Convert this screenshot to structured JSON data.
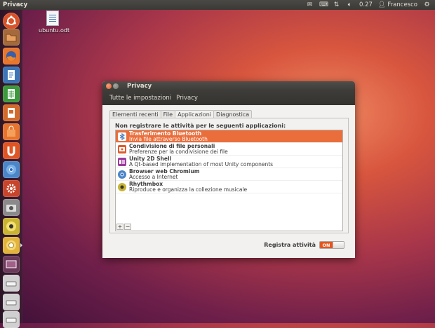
{
  "top_panel": {
    "app_title": "Privacy",
    "clock": "0.27",
    "user": "Francesco",
    "icons": [
      "mail-icon",
      "keyboard-icon",
      "network-icon",
      "volume-icon",
      "gear-icon"
    ]
  },
  "launcher": {
    "items": [
      {
        "name": "dash-home",
        "color": "#d8532a"
      },
      {
        "name": "files",
        "color": "#a56a3c"
      },
      {
        "name": "firefox",
        "color": "#e8762c"
      },
      {
        "name": "libreoffice-writer",
        "color": "#3a75b8"
      },
      {
        "name": "libreoffice-calc",
        "color": "#3c9a3c"
      },
      {
        "name": "libreoffice-impress",
        "color": "#d46a2a"
      },
      {
        "name": "software-center",
        "color": "#e6742e"
      },
      {
        "name": "ubuntu-one",
        "color": "#e05522"
      },
      {
        "name": "chromium",
        "color": "#4a86c8"
      },
      {
        "name": "system-settings",
        "color": "#c8442a"
      },
      {
        "name": "camera",
        "color": "#8a8a8a"
      },
      {
        "name": "rhythmbox",
        "color": "#c8b432"
      },
      {
        "name": "privacy",
        "color": "#e2b43a"
      },
      {
        "name": "workspace",
        "color": "#6b3a5a"
      },
      {
        "name": "drive-1",
        "color": "#d0d0d0"
      },
      {
        "name": "drive-2",
        "color": "#d0d0d0"
      },
      {
        "name": "drive-3",
        "color": "#d0d0d0"
      }
    ]
  },
  "desktop": {
    "file_label": "ubuntu.odt"
  },
  "window": {
    "title": "Privacy",
    "toolbar": {
      "all_settings": "Tutte le impostazioni",
      "current": "Privacy"
    },
    "tabs": [
      "Elementi recenti",
      "File",
      "Applicazioni",
      "Diagnostica"
    ],
    "active_tab": "Applicazioni",
    "heading": "Non registrare le attività per le seguenti applicazioni:",
    "apps": [
      {
        "name": "Trasferimento Bluetooth",
        "desc": "Invia file attraverso Bluetooth",
        "icon": "bluetooth-icon",
        "color": "#4a7bb8",
        "selected": true
      },
      {
        "name": "Condivisione di file personali",
        "desc": "Preferenze per la condivisione dei file",
        "icon": "file-share-icon",
        "color": "#e05a2c",
        "selected": false
      },
      {
        "name": "Unity 2D Shell",
        "desc": "A Qt-based implementation of most Unity components",
        "icon": "unity-icon",
        "color": "#9b3a9b",
        "selected": false
      },
      {
        "name": "Browser web Chromium",
        "desc": "Accesso a Internet",
        "icon": "chromium-icon",
        "color": "#4a86c8",
        "selected": false
      },
      {
        "name": "Rhythmbox",
        "desc": "Riproduce e organizza la collezione musicale",
        "icon": "rhythmbox-icon",
        "color": "#c8b432",
        "selected": false
      }
    ],
    "add_label": "+",
    "remove_label": "−",
    "record_label": "Registra attività",
    "toggle_label": "ON"
  }
}
